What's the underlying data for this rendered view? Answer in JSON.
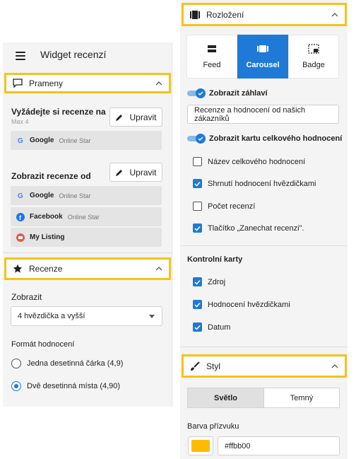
{
  "header": {
    "title": "Widget recenzí"
  },
  "sections": {
    "sources": {
      "label": "Prameny",
      "icon": "message-square-icon"
    },
    "reviews": {
      "label": "Recenze",
      "icon": "star-icon"
    },
    "layout": {
      "label": "Rozložení",
      "icon": "layout-icon"
    },
    "style": {
      "label": "Styl",
      "icon": "brush-icon"
    }
  },
  "sources_panel": {
    "request_title": "Vyžádejte si recenze na",
    "request_max": "Max 4",
    "edit_label": "Upravit",
    "request_sources": [
      {
        "name": "Google",
        "sub": "Online Star",
        "icon": "google-icon"
      }
    ],
    "show_title": "Zobrazit recenze od",
    "show_sources": [
      {
        "name": "Google",
        "sub": "Online Star",
        "icon": "google-icon"
      },
      {
        "name": "Facebook",
        "sub": "Online Star",
        "icon": "facebook-icon"
      },
      {
        "name": "My Listing",
        "sub": "",
        "icon": "my-listing-icon"
      }
    ]
  },
  "reviews_panel": {
    "show_label": "Zobrazit",
    "show_value": "4 hvězdička a vyšší",
    "format_label": "Formát hodnocení",
    "format_options": [
      {
        "label": "Jedna desetinná čárka (4,9)",
        "selected": false
      },
      {
        "label": "Dvě desetinná místa (4,90)",
        "selected": true
      }
    ]
  },
  "layout_panel": {
    "options": [
      {
        "label": "Feed",
        "icon": "feed-icon",
        "active": false
      },
      {
        "label": "Carousel",
        "icon": "carousel-icon",
        "active": true
      },
      {
        "label": "Badge",
        "icon": "badge-icon",
        "active": false
      }
    ],
    "show_header_label": "Zobrazit záhlaví",
    "show_header_on": true,
    "header_text": "Recenze a hodnocení od našich zákazníků",
    "show_summary_label": "Zobrazit kartu celkového hodnocení",
    "show_summary_on": true,
    "summary_items": [
      {
        "label": "Název celkového hodnocení",
        "checked": false
      },
      {
        "label": "Shrnutí hodnocení hvězdičkami",
        "checked": true
      },
      {
        "label": "Počet recenzí",
        "checked": false
      },
      {
        "label": "Tlačítko „Zanechat recenzi\".",
        "checked": true
      }
    ],
    "control_cards_label": "Kontrolní karty",
    "control_items": [
      {
        "label": "Zdroj",
        "checked": true
      },
      {
        "label": "Hodnocení hvězdičkami",
        "checked": true
      },
      {
        "label": "Datum",
        "checked": true
      }
    ]
  },
  "style_panel": {
    "themes": [
      {
        "label": "Světlo",
        "active": true
      },
      {
        "label": "Temný",
        "active": false
      }
    ],
    "accent_label": "Barva přízvuku",
    "accent_value": "#ffbb00"
  },
  "colors": {
    "highlight": "#f6c21c",
    "primary": "#1e7ad6",
    "accent": "#ffbb00"
  }
}
